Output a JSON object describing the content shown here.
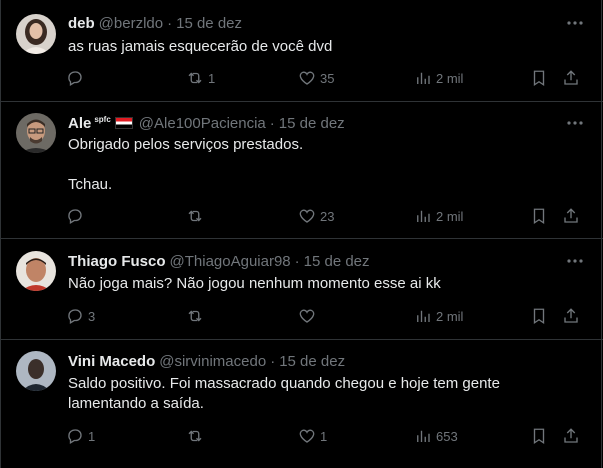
{
  "tweets": [
    {
      "name": "deb",
      "handle": "@berzldo",
      "date": "15 de dez",
      "text": "as ruas jamais esquecerão de você dvd",
      "replies": "",
      "reposts": "1",
      "likes": "35",
      "views": "2 mil",
      "avatar_color": "#c9b6a8"
    },
    {
      "name": "Ale",
      "badge": "spfc",
      "handle": "@Ale100Paciencia",
      "date": "15 de dez",
      "text": "Obrigado pelos serviços prestados.\n\nTchau.",
      "replies": "",
      "reposts": "",
      "likes": "23",
      "views": "2 mil",
      "avatar_color": "#8a6f5c"
    },
    {
      "name": "Thiago Fusco",
      "handle": "@ThiagoAguiar98",
      "date": "15 de dez",
      "text": "Não joga mais? Não jogou nenhum momento esse ai kk",
      "replies": "3",
      "reposts": "",
      "likes": "",
      "views": "2 mil",
      "avatar_color": "#b07f6a"
    },
    {
      "name": "Vini Macedo",
      "handle": "@sirvinimacedo",
      "date": "15 de dez",
      "text": "Saldo positivo. Foi massacrado quando chegou e hoje tem gente lamentando a saída.",
      "replies": "1",
      "reposts": "",
      "likes": "1",
      "views": "653",
      "avatar_color": "#5a6470"
    }
  ],
  "colors": {
    "background": "#000000",
    "text": "#e7e9ea",
    "muted": "#71767b",
    "divider": "#2f3336"
  }
}
